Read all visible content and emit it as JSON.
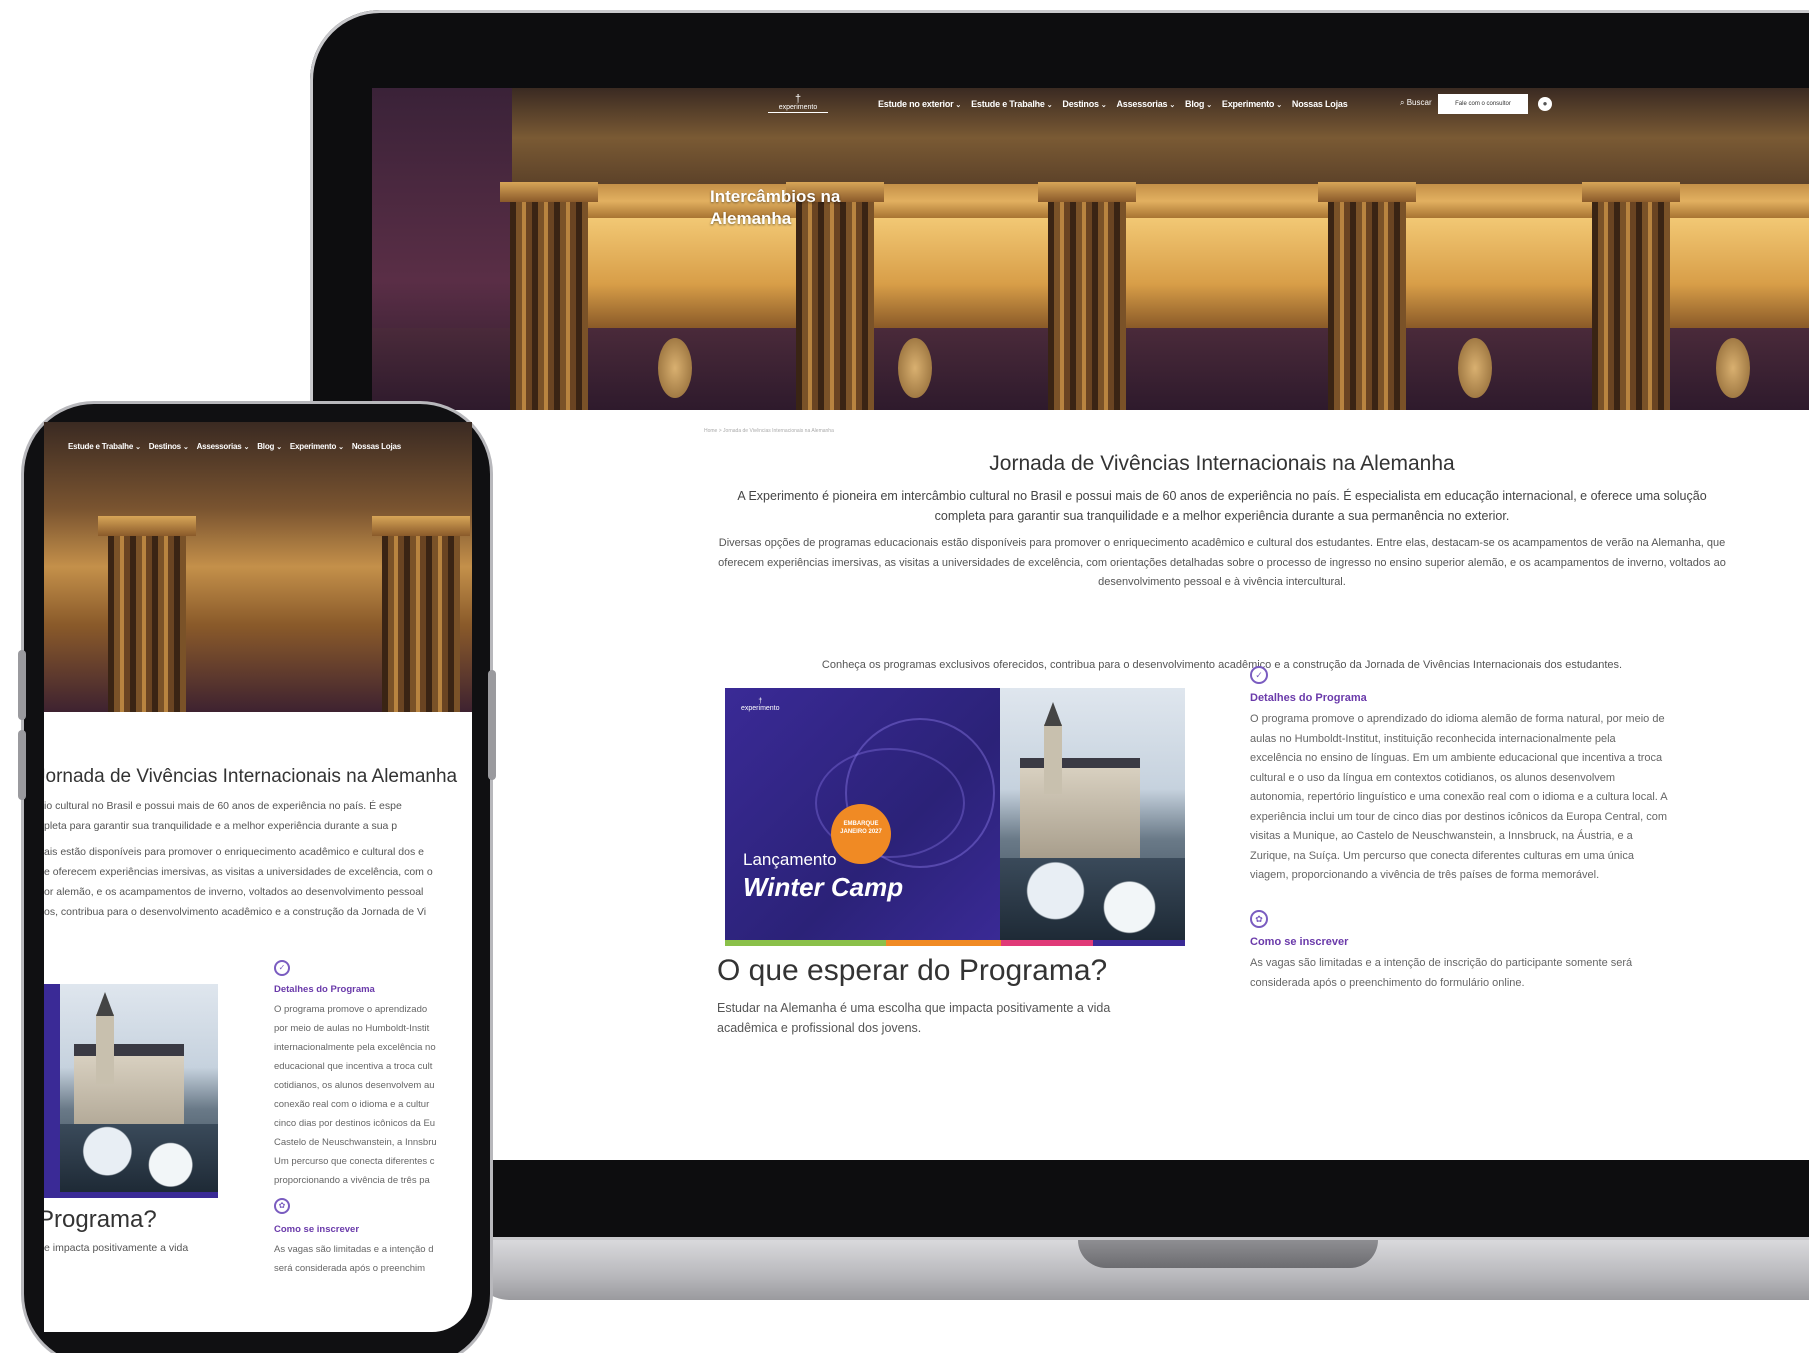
{
  "nav": {
    "logo": "experimento",
    "items": [
      "Estude no exterior",
      "Estude e Trabalhe",
      "Destinos",
      "Assessorias",
      "Blog",
      "Experimento",
      "Nossas Lojas"
    ],
    "search_label": "Buscar",
    "cta_label": "Fale com o consultor"
  },
  "hero": {
    "title": "Intercâmbios na Alemanha"
  },
  "breadcrumb": "Home  >  Jornada de Vivências Internacionais na Alemanha",
  "main": {
    "heading": "Jornada de Vivências Internacionais na Alemanha",
    "lead": "A Experimento é pioneira em intercâmbio cultural no Brasil e possui mais de 60 anos de experiência no país. É especialista em educação internacional, e oferece uma solução completa para garantir sua tranquilidade e a melhor experiência durante a sua permanência no exterior.",
    "paragraph": "Diversas opções de programas educacionais estão disponíveis para promover o enriquecimento acadêmico e cultural dos estudantes. Entre elas, destacam-se os acampamentos de verão na Alemanha, que oferecem experiências imersivas, as visitas a universidades de excelência, com orientações detalhadas sobre o processo de ingresso no ensino superior alemão, e os acampamentos de inverno, voltados ao desenvolvimento pessoal e à vivência intercultural.",
    "paragraph2": "Conheça os programas exclusivos oferecidos, contribua para o desenvolvimento acadêmico e a construção da Jornada de Vivências Internacionais dos estudantes."
  },
  "promo": {
    "logo": "experimento",
    "badge": "EMBARQUE JANEIRO 2027",
    "launch": "Lançamento",
    "camp": "Winter Camp"
  },
  "what": {
    "heading": "O que esperar do Programa?",
    "text": "Estudar na Alemanha é uma escolha que impacta positivamente a vida acadêmica e profissional dos jovens."
  },
  "details": {
    "title": "Detalhes do Programa",
    "text": "O programa promove o aprendizado do idioma alemão de forma natural, por meio de aulas no Humboldt-Institut, instituição reconhecida internacionalmente pela excelência no ensino de línguas. Em um ambiente educacional que incentiva a troca cultural e o uso da língua em contextos cotidianos, os alunos desenvolvem autonomia, repertório linguístico e uma conexão real com o idioma e a cultura local. A experiência inclui um tour de cinco dias por destinos icônicos da Europa Central, com visitas a Munique, ao Castelo de Neuschwanstein, a Innsbruck, na Áustria, e a Zurique, na Suíça. Um percurso que conecta diferentes culturas em uma única viagem, proporcionando a vivência de três países de forma memorável."
  },
  "enroll": {
    "title": "Como se inscrever",
    "text": "As vagas são limitadas e a intenção de inscrição do participante somente será considerada após o preenchimento do formulário online."
  },
  "phone": {
    "nav_items": [
      "Estude e Trabalhe",
      "Destinos",
      "Assessorias",
      "Blog",
      "Experimento",
      "Nossas Lojas"
    ],
    "heading": "Jornada de Vivências Internacionais na Alemanha",
    "lines": [
      "io cultural no Brasil e possui mais de 60 anos de experiência no país. É espe",
      "pleta para garantir sua tranquilidade e a melhor experiência durante a sua p",
      "ais estão disponíveis para promover o enriquecimento acadêmico e cultural dos e",
      "e oferecem experiências imersivas, as visitas a universidades de excelência, com o",
      "or alemão, e os acampamentos de inverno, voltados ao desenvolvimento pessoal",
      "os, contribua para o desenvolvimento acadêmico e a construção da Jornada de Vi"
    ],
    "what_heading": "Programa?",
    "what_text": "e impacta positivamente a vida",
    "details_title": "Detalhes do Programa",
    "details_lines": [
      "O programa promove o aprendizado",
      "por meio de aulas no Humboldt-Instit",
      "internacionalmente pela excelência no",
      "educacional que incentiva a troca cult",
      "cotidianos, os alunos desenvolvem au",
      "conexão real com o idioma e a cultur",
      "cinco dias por destinos icônicos da Eu",
      "Castelo de Neuschwanstein, a Innsbru",
      "Um percurso que conecta diferentes c",
      "proporcionando a vivência de três pa"
    ],
    "enroll_title": "Como se inscrever",
    "enroll_lines": [
      "As vagas são limitadas e a intenção d",
      "será considerada após o preenchim"
    ]
  },
  "colors": {
    "accent": "#6a3aaa",
    "promo_bg": "#3a2a96",
    "badge": "#f08a24"
  }
}
